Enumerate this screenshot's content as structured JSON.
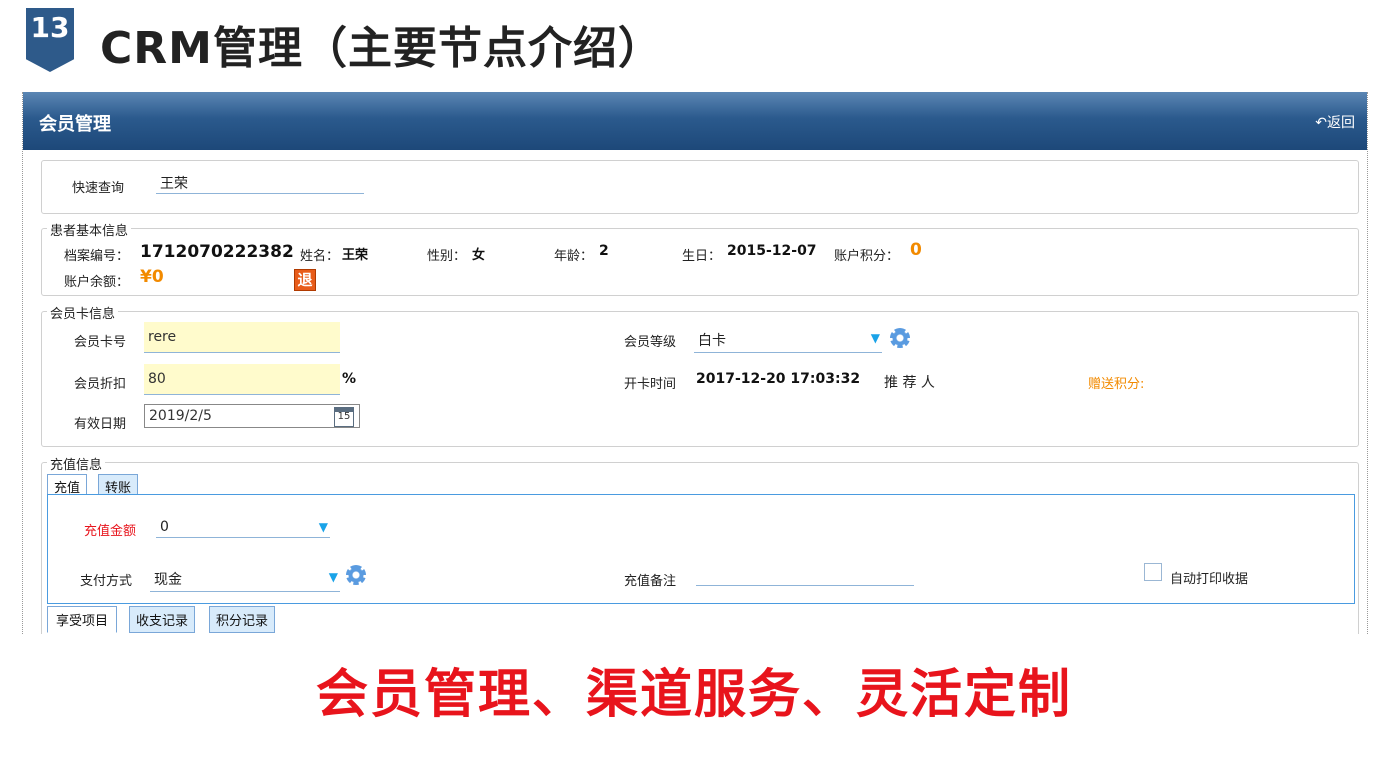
{
  "slide": {
    "number": "13",
    "title": "CRM管理（主要节点介绍）",
    "slogan": "会员管理、渠道服务、灵活定制"
  },
  "header": {
    "title": "会员管理",
    "back_label": "↶返回"
  },
  "quick_search": {
    "label": "快速查询",
    "value": "王荣"
  },
  "patient": {
    "legend": "患者基本信息",
    "file_no_label": "档案编号：",
    "file_no": "1712070222382",
    "name_label": "姓名：",
    "name": "王荣",
    "gender_label": "性别：",
    "gender": "女",
    "age_label": "年龄：",
    "age": "2",
    "birthday_label": "生日：",
    "birthday": "2015-12-07",
    "points_label": "账户积分：",
    "points": "0",
    "balance_label": "账户余额：",
    "balance": "¥0",
    "refund_label": "退"
  },
  "card": {
    "legend": "会员卡信息",
    "card_no_label": "会员卡号",
    "card_no": "rere",
    "discount_label": "会员折扣",
    "discount": "80",
    "percent": "%",
    "expiry_label": "有效日期",
    "expiry": "2019/2/5",
    "calendar_day": "15",
    "level_label": "会员等级",
    "level": "白卡",
    "open_time_label": "开卡时间",
    "open_time": "2017-12-20 17:03:32",
    "referrer_label": "推 荐 人",
    "gift_points_label": "赠送积分:"
  },
  "recharge": {
    "legend": "充值信息",
    "tabs": [
      "充值",
      "转账"
    ],
    "amount_label": "充值金额",
    "amount": "0",
    "pay_method_label": "支付方式",
    "pay_method": "现金",
    "remark_label": "充值备注",
    "remark": "",
    "auto_print_label": "自动打印收据"
  },
  "bottom_tabs": [
    "享受项目",
    "收支记录",
    "积分记录"
  ],
  "colors": {
    "header": "#2b5a8d",
    "accent_orange": "#f28a00",
    "required_red": "#e8141c",
    "input_yellow": "#fffbcc"
  }
}
